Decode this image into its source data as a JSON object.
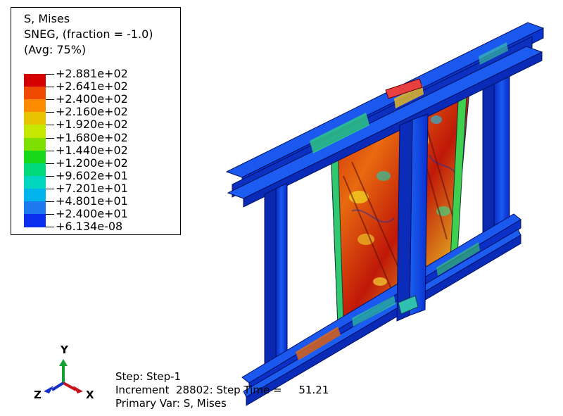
{
  "legend": {
    "title_lines": [
      "S, Mises",
      "SNEG, (fraction = -1.0)",
      "(Avg: 75%)"
    ],
    "levels": [
      "+2.881e+02",
      "+2.641e+02",
      "+2.400e+02",
      "+2.160e+02",
      "+1.920e+02",
      "+1.680e+02",
      "+1.440e+02",
      "+1.200e+02",
      "+9.602e+01",
      "+7.201e+01",
      "+4.801e+01",
      "+2.400e+01",
      "+6.134e-08"
    ],
    "colors": [
      "#d40000",
      "#ef4a00",
      "#ff8c00",
      "#e8c400",
      "#c4e800",
      "#7ee000",
      "#18d818",
      "#00d87a",
      "#00d6c0",
      "#00b4ec",
      "#1e78f0",
      "#0a2ef0"
    ]
  },
  "info": {
    "step": "Step: Step-1",
    "increment": "Increment  28802: Step Time =     51.21",
    "primary_var": "Primary Var: S, Mises"
  },
  "triad": {
    "x_label": "X",
    "y_label": "Y",
    "z_label": "Z",
    "x_color": "#c8141e",
    "y_color": "#14a032",
    "z_color": "#1432c8"
  }
}
